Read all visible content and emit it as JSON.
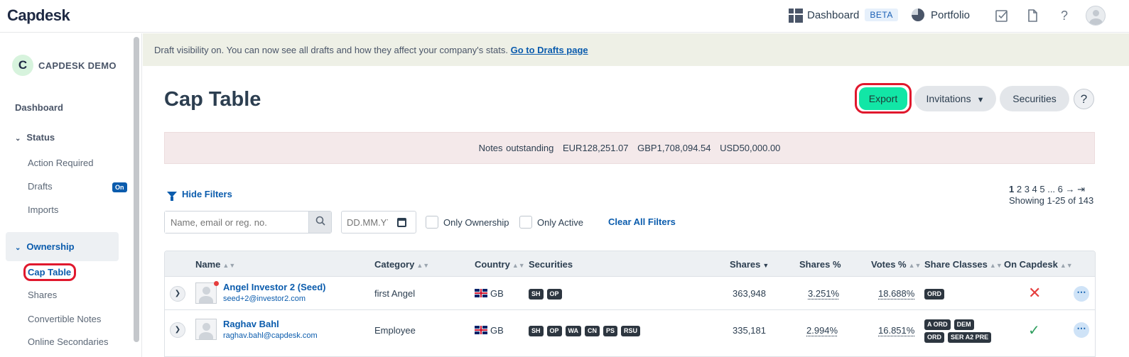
{
  "topbar": {
    "logo": "Capdesk",
    "dashboard_label": "Dashboard",
    "beta_label": "BETA",
    "portfolio_label": "Portfolio",
    "tasks_icon": "checkbox-icon",
    "docs_icon": "document-icon",
    "help_icon": "?",
    "avatar_icon": "user-avatar-icon"
  },
  "sidebar": {
    "company_initial": "C",
    "company_name": "CAPDESK DEMO",
    "dashboard": "Dashboard",
    "status": "Status",
    "action_required": "Action Required",
    "drafts": "Drafts",
    "drafts_badge": "On",
    "imports": "Imports",
    "ownership": "Ownership",
    "cap_table": "Cap Table",
    "shares": "Shares",
    "convertible_notes": "Convertible Notes",
    "online_secondaries": "Online Secondaries"
  },
  "banner": {
    "text": "Draft visibility on. You can now see all drafts and how they affect your company's stats.",
    "link": "Go to Drafts page"
  },
  "page": {
    "title": "Cap Table",
    "export": "Export",
    "invitations": "Invitations",
    "securities": "Securities",
    "help": "?"
  },
  "notes": {
    "label": "Notes outstanding",
    "eur": "EUR128,251.07",
    "gbp": "GBP1,708,094.54",
    "usd": "USD50,000.00"
  },
  "filters": {
    "hide_filters": "Hide Filters",
    "search_placeholder": "Name, email or reg. no.",
    "date_placeholder": "DD.MM.YY",
    "only_ownership": "Only Ownership",
    "only_active": "Only Active",
    "clear_all": "Clear All Filters"
  },
  "pagination": {
    "pages": "1 2 3 4 5 ... 6 → ⇥",
    "current": "1",
    "showing": "Showing 1-25 of 143"
  },
  "table": {
    "headers": {
      "name": "Name",
      "category": "Category",
      "country": "Country",
      "securities": "Securities",
      "shares": "Shares",
      "shares_pct": "Shares %",
      "votes_pct": "Votes %",
      "share_classes": "Share Classes",
      "on_capdesk": "On Capdesk"
    },
    "rows": [
      {
        "name": "Angel Investor 2 (Seed)",
        "email": "seed+2@investor2.com",
        "category": "first Angel",
        "country": "GB",
        "securities": [
          "SH",
          "OP"
        ],
        "shares": "363,948",
        "shares_pct": "3.251%",
        "votes_pct": "18.688%",
        "share_classes": [
          "ORD"
        ],
        "on_capdesk": false
      },
      {
        "name": "Raghav Bahl",
        "email": "raghav.bahl@capdesk.com",
        "category": "Employee",
        "country": "GB",
        "securities": [
          "SH",
          "OP",
          "WA",
          "CN",
          "PS",
          "RSU"
        ],
        "shares": "335,181",
        "shares_pct": "2.994%",
        "votes_pct": "16.851%",
        "share_classes": [
          "A ORD",
          "DEM",
          "ORD",
          "SER A2 PRE"
        ],
        "on_capdesk": true
      }
    ]
  },
  "colors": {
    "accent": "#0b5cad",
    "export": "#12e6a6",
    "highlight": "#e0182d"
  }
}
